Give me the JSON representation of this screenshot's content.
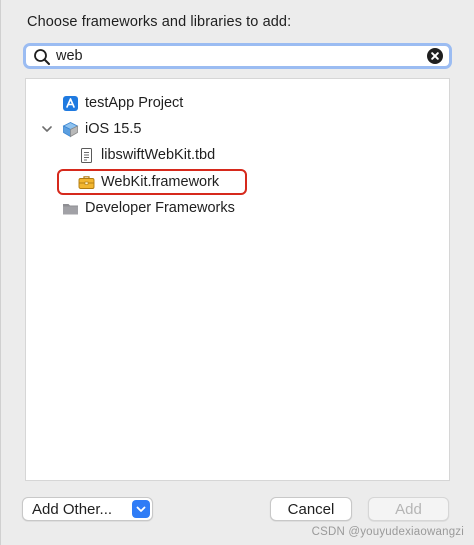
{
  "dialog": {
    "prompt": "Choose frameworks and libraries to add:"
  },
  "search": {
    "value": "web",
    "search_icon": "magnifier-icon",
    "clear_icon": "clear-circle-icon"
  },
  "tree": {
    "items": [
      {
        "label": "testApp Project",
        "icon": "xcode-project-icon"
      },
      {
        "label": "iOS 15.5",
        "icon": "sdk-icon",
        "expanded": true
      },
      {
        "label": "libswiftWebKit.tbd",
        "icon": "document-icon"
      },
      {
        "label": "WebKit.framework",
        "icon": "toolbox-icon",
        "highlighted": true
      },
      {
        "label": "Developer Frameworks",
        "icon": "folder-icon"
      }
    ]
  },
  "buttons": {
    "add_other": "Add Other...",
    "cancel": "Cancel",
    "add": "Add"
  },
  "watermark": "CSDN @youyudexiaowangzi",
  "colors": {
    "accent": "#2f7cf6",
    "highlight_box": "#d6291c",
    "search_focus": "#9bbcf2"
  }
}
